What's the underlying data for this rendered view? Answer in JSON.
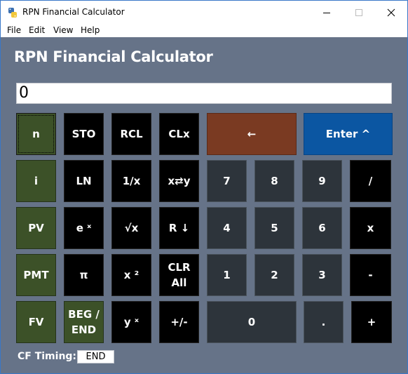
{
  "window": {
    "title": "RPN Financial Calculator",
    "minimize_icon": "minimize-icon",
    "maximize_icon": "maximize-icon",
    "close_icon": "close-icon"
  },
  "menu": [
    "File",
    "Edit",
    "View",
    "Help"
  ],
  "heading": "RPN Financial Calculator",
  "display": "0",
  "buttons": {
    "n": "n",
    "sto": "STO",
    "rcl": "RCL",
    "clx": "CLx",
    "backspace": "←",
    "enter": "Enter ^",
    "i": "i",
    "ln": "LN",
    "recip": "1/x",
    "swap": "x⇄y",
    "d7": "7",
    "d8": "8",
    "d9": "9",
    "div": "/",
    "pv": "PV",
    "ex": "e ˣ",
    "sqrt": "√x",
    "rdown": "R ↓",
    "d4": "4",
    "d5": "5",
    "d6": "6",
    "mul": "x",
    "pmt": "PMT",
    "pi": "π",
    "sq": "x ²",
    "clrall": "CLR\nAll",
    "d1": "1",
    "d2": "2",
    "d3": "3",
    "sub": "-",
    "fv": "FV",
    "begend": "BEG /\nEND",
    "yx": "y ˣ",
    "chs": "+/-",
    "d0": "0",
    "dot": ".",
    "add": "+"
  },
  "cf_timing": {
    "label": "CF Timing:",
    "value": "END"
  },
  "colors": {
    "background": "#667388",
    "financial_button": "#3c5128",
    "function_button": "#000000",
    "digit_button": "#2d343b",
    "backspace_button": "#7a3a22",
    "enter_button": "#0b56a2"
  }
}
